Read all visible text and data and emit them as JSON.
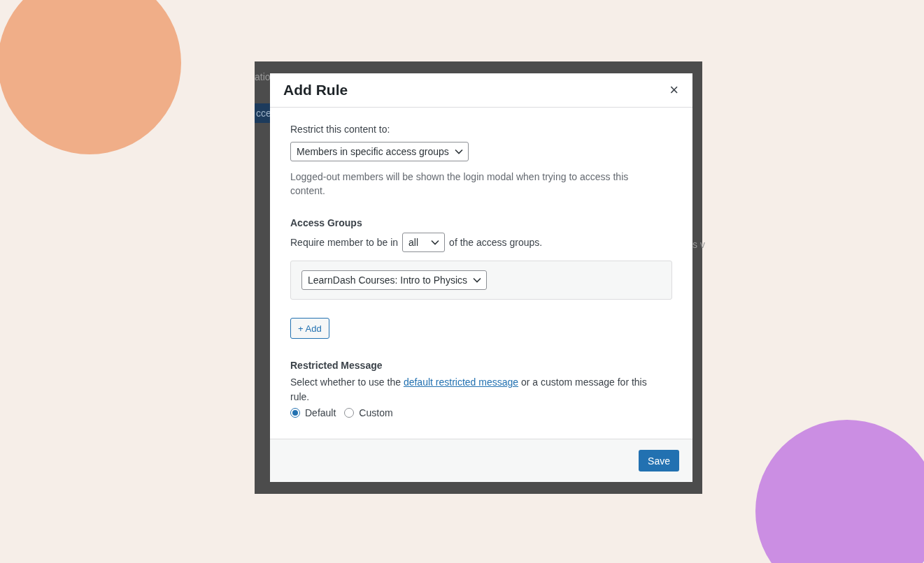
{
  "backdrop": {
    "fragments": [
      {
        "text": "atio",
        "kind": "tab"
      },
      {
        "text": "cce",
        "kind": "button"
      },
      {
        "text": "s v",
        "kind": "text"
      }
    ]
  },
  "modal": {
    "title": "Add Rule",
    "close": "×",
    "restrict": {
      "label": "Restrict this content to:",
      "value": "Members in specific access groups",
      "help": "Logged-out members will be shown the login modal when trying to access this content."
    },
    "access_groups": {
      "heading": "Access Groups",
      "before": "Require member to be in",
      "match": "all",
      "after": "of the access groups.",
      "groups": [
        "LearnDash Courses: Intro to Physics"
      ],
      "add_button": "+ Add"
    },
    "restricted_message": {
      "heading": "Restricted Message",
      "description_before": "Select whether to use the",
      "link": "default restricted message",
      "description_after": "or a custom message for this rule.",
      "options": [
        {
          "label": "Default",
          "selected": true
        },
        {
          "label": "Custom",
          "selected": false
        }
      ]
    },
    "save_button": "Save"
  }
}
